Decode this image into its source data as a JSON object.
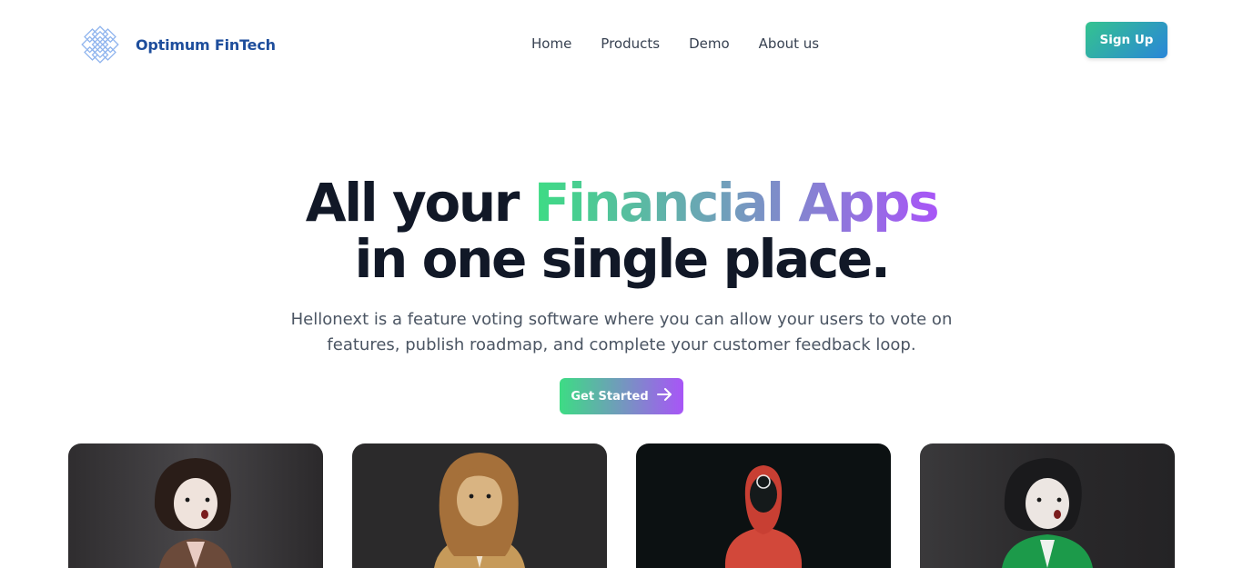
{
  "brand": {
    "name": "Optimum FinTech",
    "logo_icon": "interlaced-knot-logo-icon",
    "color": "#1e4e9c"
  },
  "nav": {
    "items": [
      {
        "label": "Home"
      },
      {
        "label": "Products"
      },
      {
        "label": "Demo"
      },
      {
        "label": "About us"
      }
    ],
    "signup_label": "Sign Up"
  },
  "hero": {
    "title_before": "All your ",
    "title_highlight": "Financial Apps",
    "title_after": " in one single place.",
    "subtitle": "Hellonext is a feature voting software where you can allow your users to vote on features, publish roadmap, and complete your customer feedback loop.",
    "cta_label": "Get Started",
    "cta_icon": "arrow-right-icon"
  },
  "colors": {
    "gradient_start": "#3ddc84",
    "gradient_end": "#a855f7",
    "signup_start": "#34c38f",
    "signup_end": "#2a86d8",
    "heading": "#111827"
  },
  "cards": [
    {
      "image": "3d-avatar-brown-hair-character"
    },
    {
      "image": "3d-avatar-blonde-hair-character"
    },
    {
      "image": "3d-avatar-red-hooded-guard-character"
    },
    {
      "image": "3d-avatar-black-hair-green-jacket-character"
    }
  ]
}
